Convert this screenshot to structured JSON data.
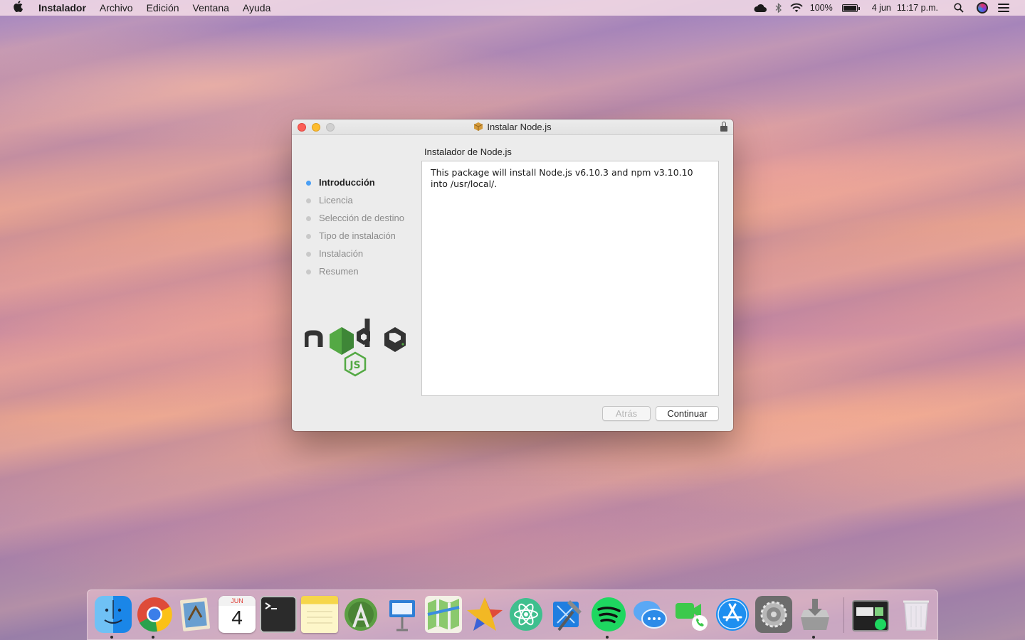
{
  "menubar": {
    "app_name": "Instalador",
    "menus": [
      "Archivo",
      "Edición",
      "Ventana",
      "Ayuda"
    ],
    "battery": "100%",
    "date": "4 jun",
    "time": "11:17 p.m."
  },
  "window": {
    "title": "Instalar Node.js",
    "content_title": "Instalador de Node.js",
    "steps": [
      "Introducción",
      "Licencia",
      "Selección de destino",
      "Tipo de instalación",
      "Instalación",
      "Resumen"
    ],
    "body_text": "This package will install Node.js v6.10.3 and npm v3.10.10\ninto /usr/local/.",
    "buttons": {
      "back": "Atrás",
      "continue": "Continuar"
    }
  },
  "dock": {
    "calendar": {
      "month": "JUN",
      "day": "4"
    },
    "apps": [
      "finder-icon",
      "chrome-icon",
      "mail-icon",
      "calendar-icon",
      "terminal-icon",
      "notes-icon",
      "android-studio-icon",
      "keynote-icon",
      "maps-icon",
      "star-app-icon",
      "atom-icon",
      "xcode-icon",
      "spotify-icon",
      "messages-icon",
      "facetime-icon",
      "app-store-icon",
      "system-preferences-icon",
      "installer-icon",
      "activity-monitor-icon",
      "trash-icon"
    ]
  }
}
